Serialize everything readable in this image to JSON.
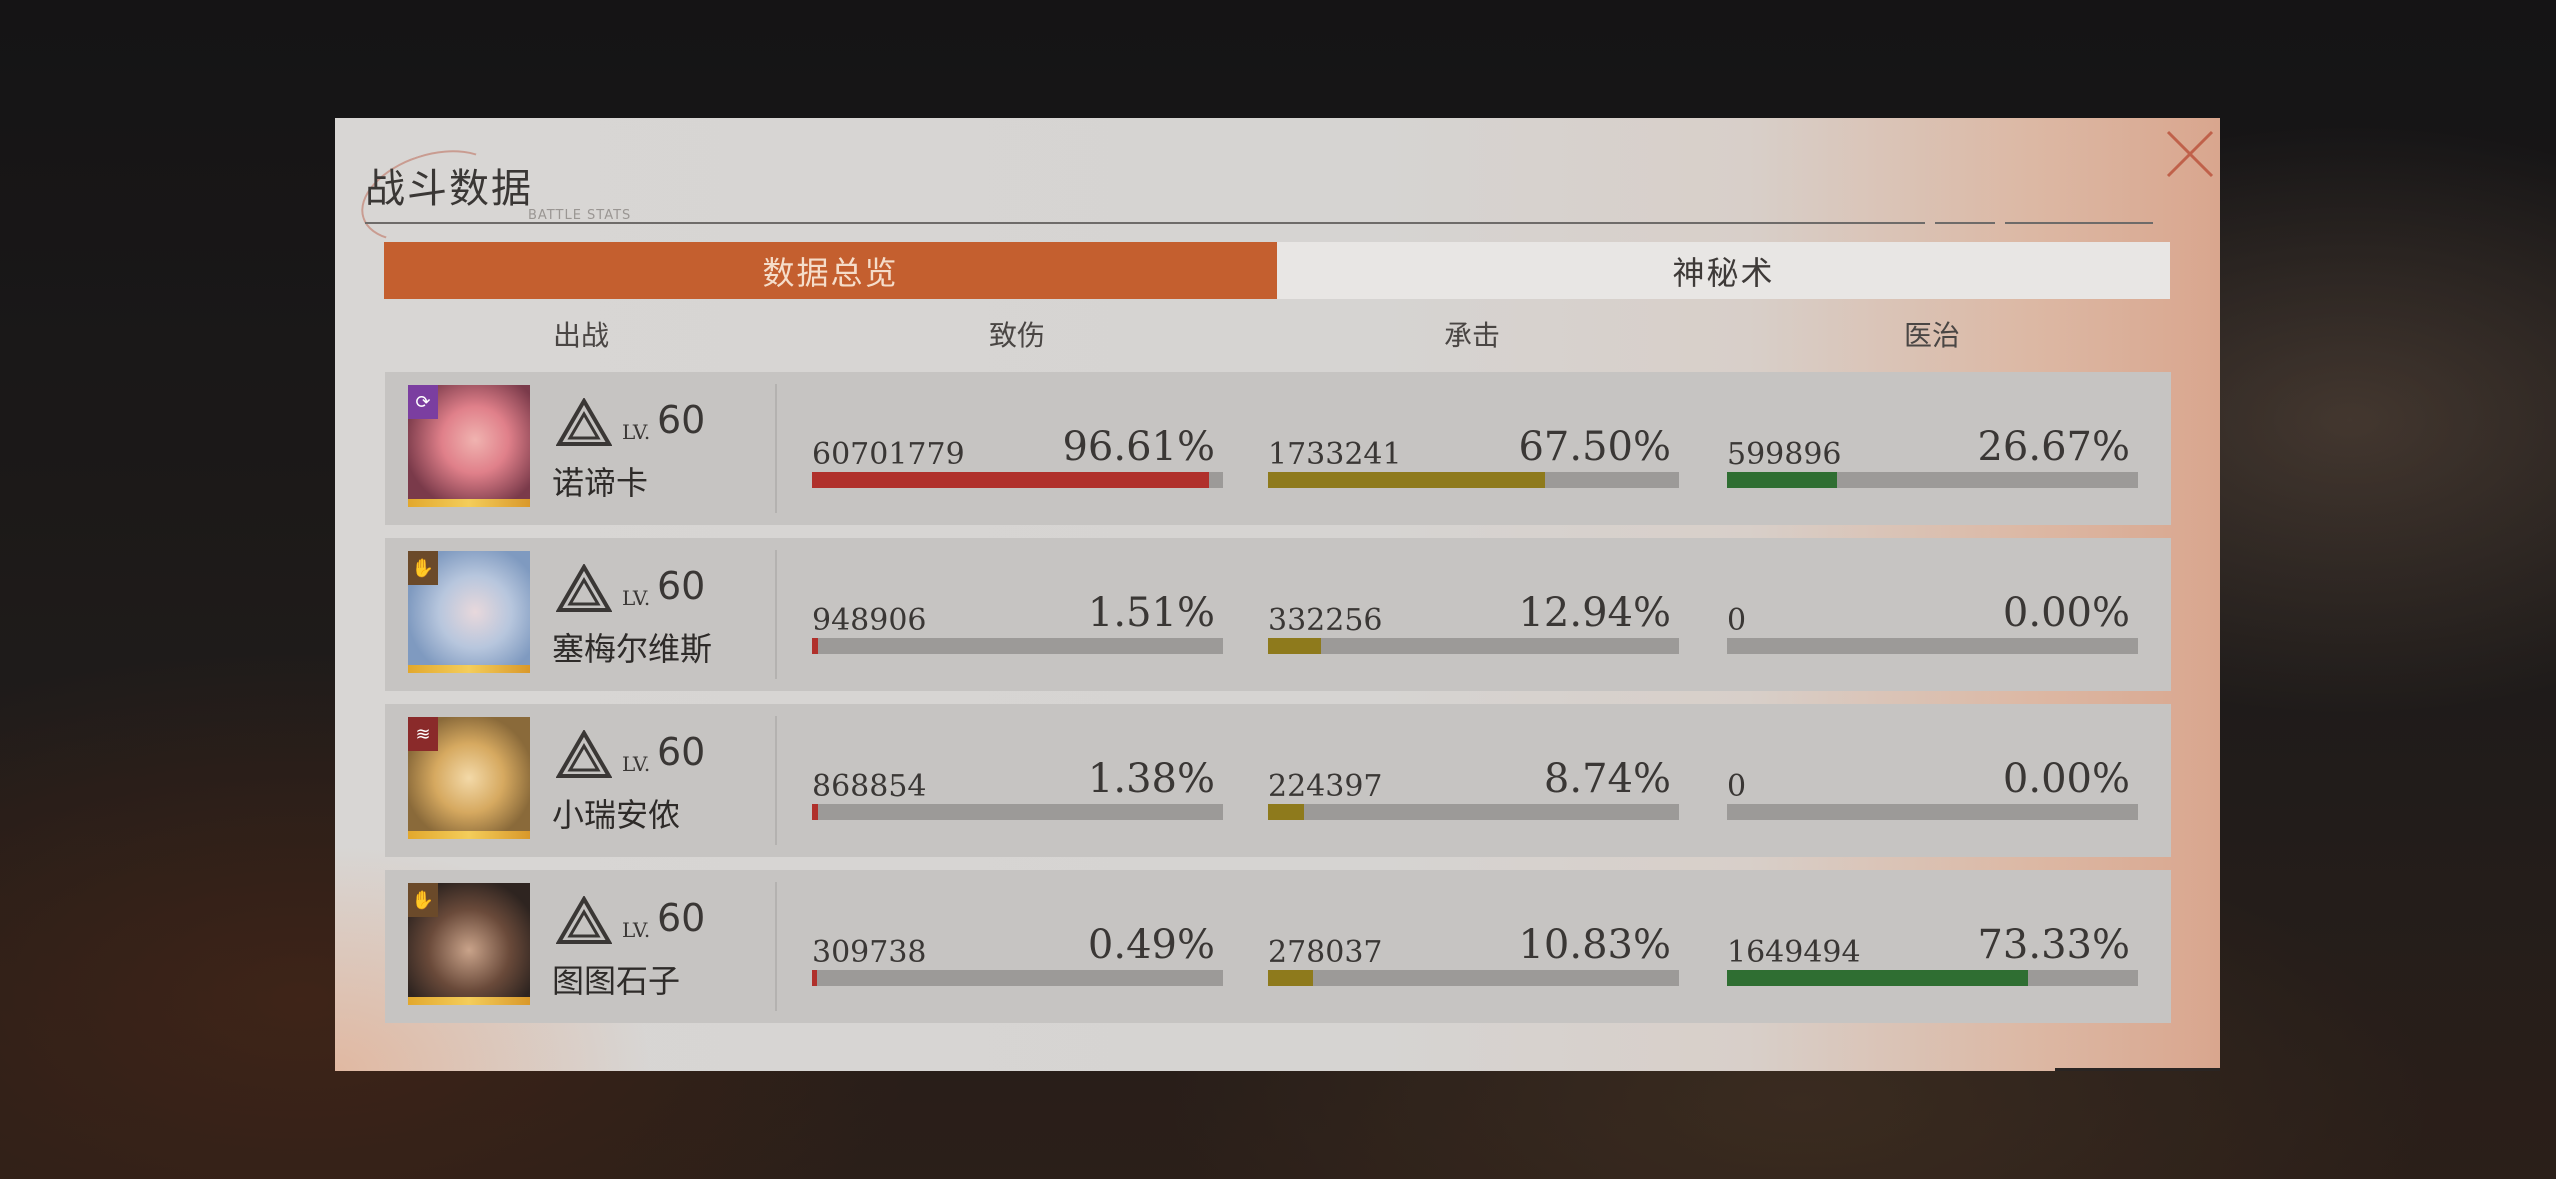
{
  "dialog": {
    "title": "战斗数据",
    "subtitle": "BATTLE STATS",
    "close_icon": "close-x-icon"
  },
  "tabs": [
    {
      "label": "数据总览",
      "active": true
    },
    {
      "label": "神秘术",
      "active": false
    }
  ],
  "columns": {
    "deploy": "出战",
    "damage": "致伤",
    "tank": "承击",
    "heal": "医治"
  },
  "colors": {
    "accent": "#c45f2f",
    "damage_bar": "#b0302b",
    "tank_bar": "#8e7a1c",
    "heal_bar": "#2f6e32",
    "bar_track": "#9c9a98"
  },
  "rows": [
    {
      "name": "诺谛卡",
      "lv_prefix": "LV.",
      "level": "60",
      "badge_icon": "cycle-icon",
      "rank_icon": "insight-triangle-icon",
      "damage": {
        "value": "60701779",
        "pct": "96.61%",
        "fraction": 0.9661
      },
      "tank": {
        "value": "1733241",
        "pct": "67.50%",
        "fraction": 0.675
      },
      "heal": {
        "value": "599896",
        "pct": "26.67%",
        "fraction": 0.2667
      }
    },
    {
      "name": "塞梅尔维斯",
      "lv_prefix": "LV.",
      "level": "60",
      "badge_icon": "hand-icon",
      "rank_icon": "insight-triangle-icon",
      "damage": {
        "value": "948906",
        "pct": "1.51%",
        "fraction": 0.0151
      },
      "tank": {
        "value": "332256",
        "pct": "12.94%",
        "fraction": 0.1294
      },
      "heal": {
        "value": "0",
        "pct": "0.00%",
        "fraction": 0
      }
    },
    {
      "name": "小瑞安侬",
      "lv_prefix": "LV.",
      "level": "60",
      "badge_icon": "claw-icon",
      "rank_icon": "insight-triangle-icon",
      "damage": {
        "value": "868854",
        "pct": "1.38%",
        "fraction": 0.0138
      },
      "tank": {
        "value": "224397",
        "pct": "8.74%",
        "fraction": 0.0874
      },
      "heal": {
        "value": "0",
        "pct": "0.00%",
        "fraction": 0
      }
    },
    {
      "name": "图图石子",
      "lv_prefix": "LV.",
      "level": "60",
      "badge_icon": "hand-icon",
      "rank_icon": "insight-triangle-icon",
      "damage": {
        "value": "309738",
        "pct": "0.49%",
        "fraction": 0.0049
      },
      "tank": {
        "value": "278037",
        "pct": "10.83%",
        "fraction": 0.1083
      },
      "heal": {
        "value": "1649494",
        "pct": "73.33%",
        "fraction": 0.7333
      }
    }
  ]
}
